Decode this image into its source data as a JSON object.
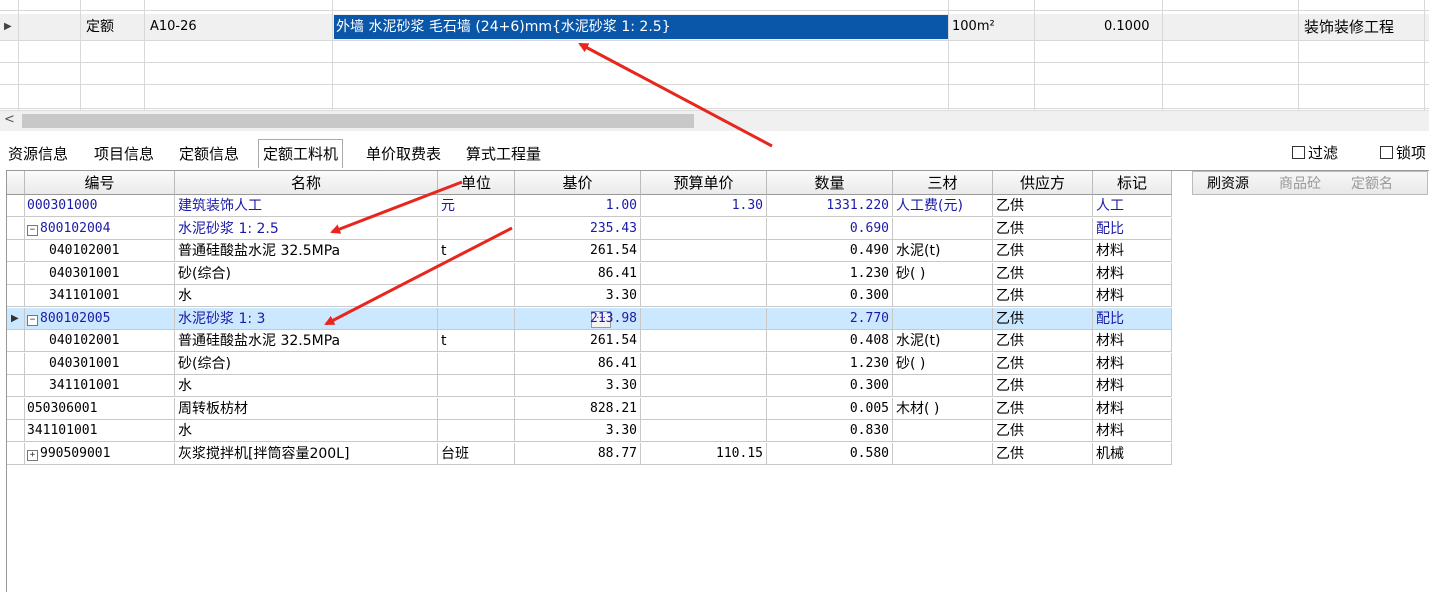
{
  "top_grid": {
    "row": {
      "type": "定额",
      "code": "A10-26",
      "name": "外墙 水泥砂浆 毛石墙 (24+6)mm{水泥砂浆 1: 2.5}",
      "unit": "100m²",
      "quantity": "0.1000",
      "category": "装饰装修工程"
    }
  },
  "tabs": [
    "资源信息",
    "项目信息",
    "定额信息",
    "定额工料机",
    "单价取费表",
    "算式工程量"
  ],
  "active_tab": 3,
  "filters": {
    "filter_label": "过滤",
    "lock_label": "锁项"
  },
  "columns": [
    "编号",
    "名称",
    "单位",
    "基价",
    "预算单价",
    "数量",
    "三材",
    "供应方",
    "标记"
  ],
  "side_buttons": [
    "刷资源",
    "商品砼",
    "定额名"
  ],
  "rows": [
    {
      "code": "000301000",
      "name": "建筑装饰人工",
      "unit": "元",
      "base": "1.00",
      "budget": "1.30",
      "qty": "1331.220",
      "material": "人工费(元)",
      "supplier": "乙供",
      "mark": "人工"
    },
    {
      "code": "800102004",
      "name": "水泥砂浆 1: 2.5",
      "unit": "",
      "base": "235.43",
      "budget": "",
      "qty": "0.690",
      "material": "",
      "supplier": "乙供",
      "mark": "配比"
    },
    {
      "code": "040102001",
      "name": "普通硅酸盐水泥 32.5MPa",
      "unit": "t",
      "base": "261.54",
      "budget": "",
      "qty": "0.490",
      "material": "水泥(t)",
      "supplier": "乙供",
      "mark": "材料"
    },
    {
      "code": "040301001",
      "name": "砂(综合)",
      "unit": "",
      "base": "86.41",
      "budget": "",
      "qty": "1.230",
      "material": "砂( )",
      "supplier": "乙供",
      "mark": "材料"
    },
    {
      "code": "341101001",
      "name": "水",
      "unit": "",
      "base": "3.30",
      "budget": "",
      "qty": "0.300",
      "material": "",
      "supplier": "乙供",
      "mark": "材料"
    },
    {
      "code": "800102005",
      "name": "水泥砂浆 1: 3",
      "unit": "",
      "base": "213.98",
      "budget": "",
      "qty": "2.770",
      "material": "",
      "supplier": "乙供",
      "mark": "配比"
    },
    {
      "code": "040102001",
      "name": "普通硅酸盐水泥 32.5MPa",
      "unit": "t",
      "base": "261.54",
      "budget": "",
      "qty": "0.408",
      "material": "水泥(t)",
      "supplier": "乙供",
      "mark": "材料"
    },
    {
      "code": "040301001",
      "name": "砂(综合)",
      "unit": "",
      "base": "86.41",
      "budget": "",
      "qty": "1.230",
      "material": "砂( )",
      "supplier": "乙供",
      "mark": "材料"
    },
    {
      "code": "341101001",
      "name": "水",
      "unit": "",
      "base": "3.30",
      "budget": "",
      "qty": "0.300",
      "material": "",
      "supplier": "乙供",
      "mark": "材料"
    },
    {
      "code": "050306001",
      "name": "周转板枋材",
      "unit": "",
      "base": "828.21",
      "budget": "",
      "qty": "0.005",
      "material": "木材( )",
      "supplier": "乙供",
      "mark": "材料"
    },
    {
      "code": "341101001",
      "name": "水",
      "unit": "",
      "base": "3.30",
      "budget": "",
      "qty": "0.830",
      "material": "",
      "supplier": "乙供",
      "mark": "材料"
    },
    {
      "code": "990509001",
      "name": "灰浆搅拌机[拌筒容量200L]",
      "unit": "台班",
      "base": "88.77",
      "budget": "110.15",
      "qty": "0.580",
      "material": "",
      "supplier": "乙供",
      "mark": "机械"
    }
  ],
  "colors": {
    "selection_blue": "#0a56a8",
    "row_highlight": "#cce8ff",
    "link_blue": "#1a1aa8",
    "arrow_red": "#e8261e"
  }
}
